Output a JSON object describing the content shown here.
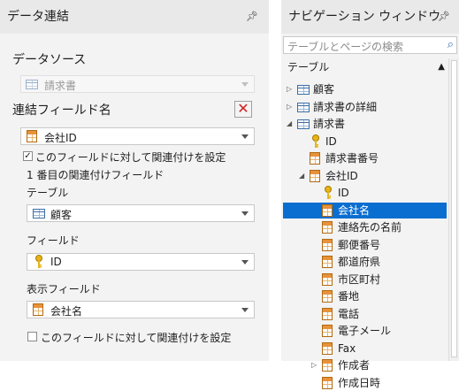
{
  "left": {
    "title": "データ連結",
    "data_source_label": "データソース",
    "data_source_value": "請求書",
    "link_field_label": "連結フィールド名",
    "link_field_value": "会社ID",
    "set_relation_label": "このフィールドに対して関連付けを設定",
    "set_relation_checked": true,
    "first_relation_label": "1 番目の関連付けフィールド",
    "table_label": "テーブル",
    "table_value": "顧客",
    "field_label": "フィールド",
    "field_value": "ID",
    "display_field_label": "表示フィールド",
    "display_field_value": "会社名",
    "set_relation2_label": "このフィールドに対して関連付けを設定",
    "set_relation2_checked": false
  },
  "right": {
    "title": "ナビゲーション ウィンドウ",
    "search_placeholder": "テーブルとページの検索",
    "tree_header": "テーブル",
    "items": [
      {
        "label": "顧客",
        "icon": "table-icon",
        "level": 0,
        "expander": "▷"
      },
      {
        "label": "請求書の詳細",
        "icon": "table-icon",
        "level": 0,
        "expander": "▷"
      },
      {
        "label": "請求書",
        "icon": "table-icon",
        "level": 0,
        "expander": "◢"
      },
      {
        "label": "ID",
        "icon": "key-icon",
        "level": 1,
        "expander": ""
      },
      {
        "label": "請求書番号",
        "icon": "field-icon",
        "level": 1,
        "expander": ""
      },
      {
        "label": "会社ID",
        "icon": "field-icon",
        "level": 1,
        "expander": "◢"
      },
      {
        "label": "ID",
        "icon": "key-icon",
        "level": 2,
        "expander": ""
      },
      {
        "label": "会社名",
        "icon": "field-icon",
        "level": 2,
        "expander": "",
        "selected": true
      },
      {
        "label": "連絡先の名前",
        "icon": "field-icon",
        "level": 2,
        "expander": ""
      },
      {
        "label": "郵便番号",
        "icon": "field-icon",
        "level": 2,
        "expander": ""
      },
      {
        "label": "都道府県",
        "icon": "field-icon",
        "level": 2,
        "expander": ""
      },
      {
        "label": "市区町村",
        "icon": "field-icon",
        "level": 2,
        "expander": ""
      },
      {
        "label": "番地",
        "icon": "field-icon",
        "level": 2,
        "expander": ""
      },
      {
        "label": "電話",
        "icon": "field-icon",
        "level": 2,
        "expander": ""
      },
      {
        "label": "電子メール",
        "icon": "field-icon",
        "level": 2,
        "expander": ""
      },
      {
        "label": "Fax",
        "icon": "field-icon",
        "level": 2,
        "expander": ""
      },
      {
        "label": "作成者",
        "icon": "field-icon",
        "level": 2,
        "expander": "▷"
      },
      {
        "label": "作成日時",
        "icon": "field-icon",
        "level": 2,
        "expander": ""
      }
    ]
  },
  "colors": {
    "selection": "#0a6ed1",
    "delete_red": "#d02020"
  }
}
